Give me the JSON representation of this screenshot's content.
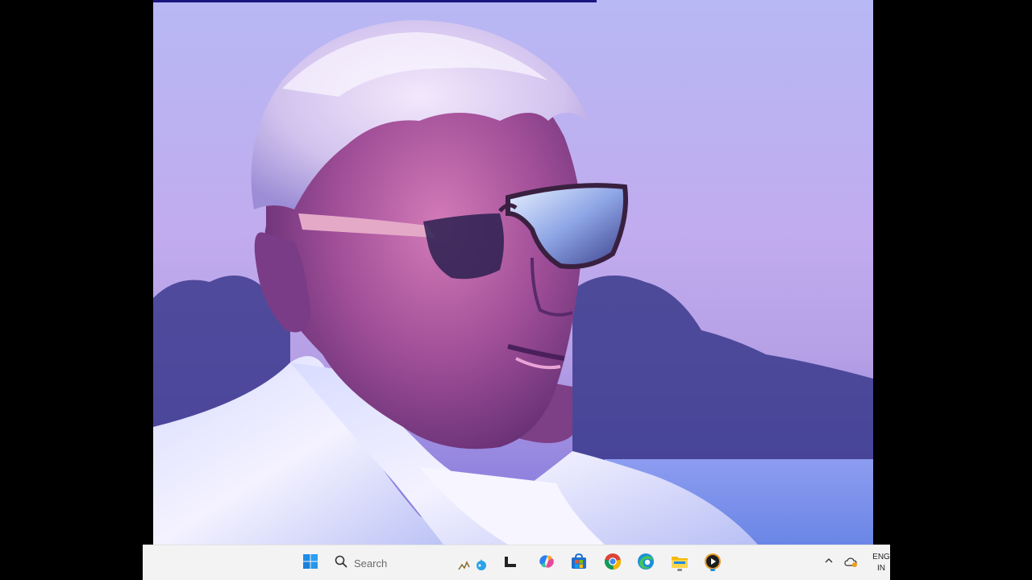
{
  "taskbar": {
    "search_label": "Search",
    "language": {
      "line1": "ENG",
      "line2": "IN"
    },
    "icons": [
      {
        "name": "start-icon"
      },
      {
        "name": "search-icon"
      },
      {
        "name": "task-view-icon"
      },
      {
        "name": "copilot-icon"
      },
      {
        "name": "microsoft-store-icon"
      },
      {
        "name": "chrome-icon"
      },
      {
        "name": "edge-icon"
      },
      {
        "name": "file-explorer-icon"
      },
      {
        "name": "media-player-icon"
      }
    ]
  },
  "colors": {
    "taskbar_bg": "#f3f3f3",
    "sky": "#b9a8ee",
    "water": "#6f8be8",
    "shirt": "#eef0ff"
  }
}
